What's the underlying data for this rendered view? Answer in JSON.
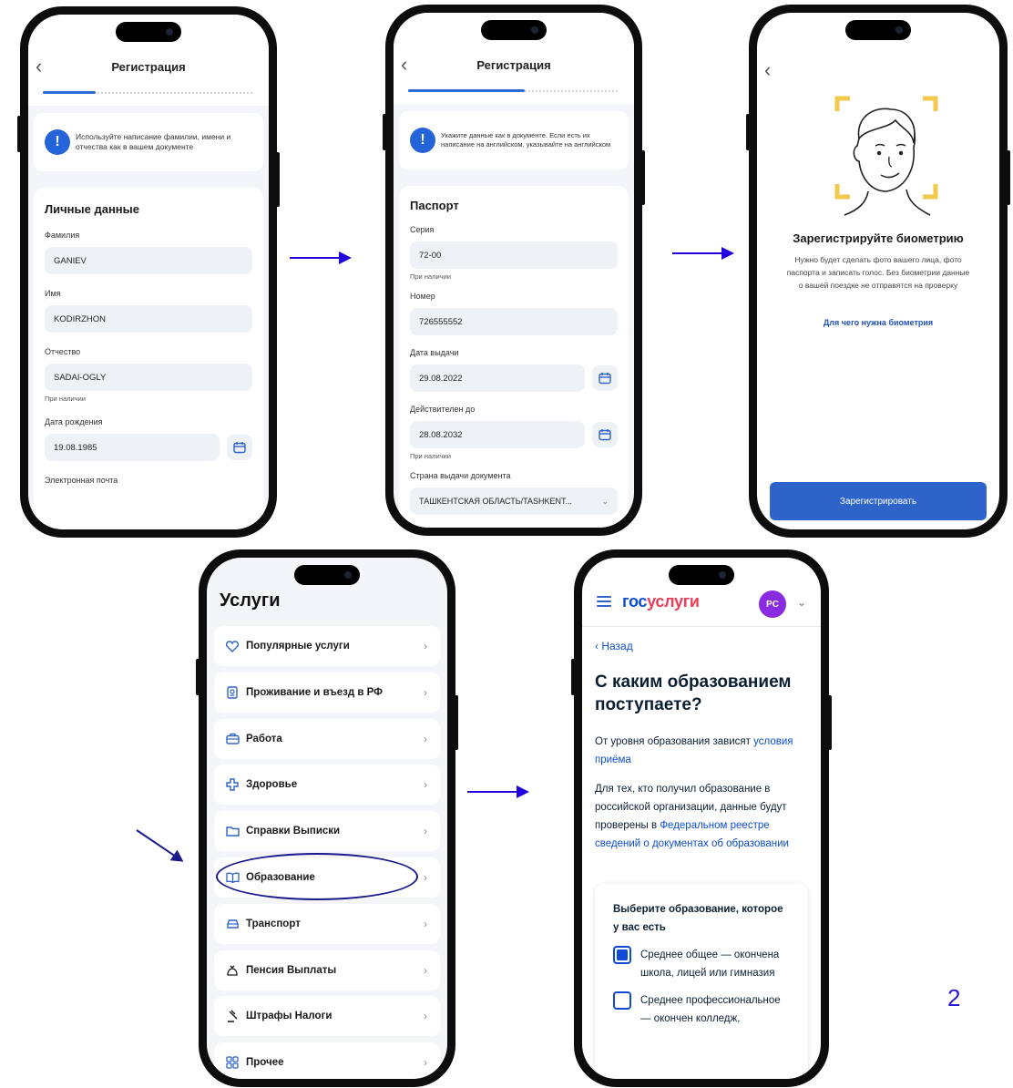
{
  "screen1": {
    "title": "Регистрация",
    "progress": 0.25,
    "notice": "Используйте написание фамилии, имени и отчества как в вашем документе",
    "section": "Личные данные",
    "lastname_label": "Фамилия",
    "lastname_value": "GANIEV",
    "firstname_label": "Имя",
    "firstname_value": "KODIRZHON",
    "patronymic_label": "Отчество",
    "patronymic_value": "SADAI-OGLY",
    "patronymic_hint": "При наличии",
    "birthdate_label": "Дата рождения",
    "birthdate_value": "19.08.1985",
    "email_label": "Электронная почта"
  },
  "screen2": {
    "title": "Регистрация",
    "progress": 0.55,
    "notice": "Укажите данные как в документе. Если есть их написание на английском, указывайте на английском",
    "section": "Паспорт",
    "series_label": "Серия",
    "series_value": "72-00",
    "series_hint": "При наличии",
    "number_label": "Номер",
    "number_value": "726555552",
    "issue_label": "Дата выдачи",
    "issue_value": "29.08.2022",
    "valid_label": "Действителен до",
    "valid_value": "28.08.2032",
    "valid_hint": "При наличии",
    "country_label": "Страна выдачи документа",
    "country_value": "ТАШКЕНТСКАЯ ОБЛАСТЬ/TASHKENT..."
  },
  "screen3": {
    "title": "Зарегистрируйте биометрию",
    "text": "Нужно будет сделать фото вашего лица, фото паспорта и записать голос. Без биометрии данные о вашей поездке не отправятся на проверку",
    "link": "Для чего нужна биометрия",
    "button": "Зарегистрировать"
  },
  "screen4": {
    "title": "Услуги",
    "items": [
      {
        "label": "Популярные услуги",
        "icon": "heart-icon"
      },
      {
        "label": "Проживание и въезд в РФ",
        "icon": "passport-icon"
      },
      {
        "label": "Работа",
        "icon": "briefcase-icon"
      },
      {
        "label": "Здоровье",
        "icon": "medical-cross-icon"
      },
      {
        "label": "Справки Выписки",
        "icon": "folder-icon"
      },
      {
        "label": "Образование",
        "icon": "book-icon"
      },
      {
        "label": "Транспорт",
        "icon": "car-icon"
      },
      {
        "label": "Пенсия Выплаты",
        "icon": "moneybag-icon"
      },
      {
        "label": "Штрафы Налоги",
        "icon": "gavel-icon"
      },
      {
        "label": "Прочее",
        "icon": "grid-icon"
      }
    ]
  },
  "screen5": {
    "logo_part1": "гос",
    "logo_part2": "услуги",
    "avatar": "PC",
    "back": "‹ Назад",
    "heading": "С каким образованием поступаете?",
    "p1_text": "От уровня образования зависят ",
    "p1_link": "условия приёма",
    "p2_text": "Для тех, кто получил образование в российской организации, данные будут проверены в ",
    "p2_link": "Федеральном реестре сведений о документах об образовании",
    "question": "Выберите образование, которое у вас есть",
    "opt1": "Среднее общее — окончена школа, лицей или гимназия",
    "opt1_checked": true,
    "opt2": "Среднее профессиональное — окончен колледж,",
    "opt2_checked": false
  },
  "annotation": {
    "number": "2"
  },
  "colors": {
    "accent": "#2e64c9",
    "arrow": "#2200dd",
    "gosuslugi_blue": "#0d4cd3",
    "gosuslugi_red": "#ee3f58",
    "avatar": "#8a2be2"
  }
}
